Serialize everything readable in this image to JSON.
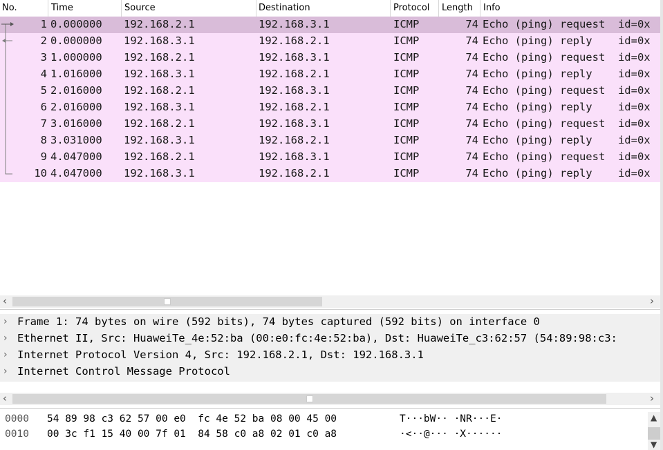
{
  "columns": {
    "no": "No.",
    "time": "Time",
    "source": "Source",
    "destination": "Destination",
    "protocol": "Protocol",
    "length": "Length",
    "info": "Info"
  },
  "packets": [
    {
      "no": "1",
      "time": "0.000000",
      "src": "192.168.2.1",
      "dst": "192.168.3.1",
      "proto": "ICMP",
      "len": "74",
      "info": "Echo (ping) request  id=0x"
    },
    {
      "no": "2",
      "time": "0.000000",
      "src": "192.168.3.1",
      "dst": "192.168.2.1",
      "proto": "ICMP",
      "len": "74",
      "info": "Echo (ping) reply    id=0x"
    },
    {
      "no": "3",
      "time": "1.000000",
      "src": "192.168.2.1",
      "dst": "192.168.3.1",
      "proto": "ICMP",
      "len": "74",
      "info": "Echo (ping) request  id=0x"
    },
    {
      "no": "4",
      "time": "1.016000",
      "src": "192.168.3.1",
      "dst": "192.168.2.1",
      "proto": "ICMP",
      "len": "74",
      "info": "Echo (ping) reply    id=0x"
    },
    {
      "no": "5",
      "time": "2.016000",
      "src": "192.168.2.1",
      "dst": "192.168.3.1",
      "proto": "ICMP",
      "len": "74",
      "info": "Echo (ping) request  id=0x"
    },
    {
      "no": "6",
      "time": "2.016000",
      "src": "192.168.3.1",
      "dst": "192.168.2.1",
      "proto": "ICMP",
      "len": "74",
      "info": "Echo (ping) reply    id=0x"
    },
    {
      "no": "7",
      "time": "3.016000",
      "src": "192.168.2.1",
      "dst": "192.168.3.1",
      "proto": "ICMP",
      "len": "74",
      "info": "Echo (ping) request  id=0x"
    },
    {
      "no": "8",
      "time": "3.031000",
      "src": "192.168.3.1",
      "dst": "192.168.2.1",
      "proto": "ICMP",
      "len": "74",
      "info": "Echo (ping) reply    id=0x"
    },
    {
      "no": "9",
      "time": "4.047000",
      "src": "192.168.2.1",
      "dst": "192.168.3.1",
      "proto": "ICMP",
      "len": "74",
      "info": "Echo (ping) request  id=0x"
    },
    {
      "no": "10",
      "time": "4.047000",
      "src": "192.168.3.1",
      "dst": "192.168.2.1",
      "proto": "ICMP",
      "len": "74",
      "info": "Echo (ping) reply    id=0x"
    }
  ],
  "details": [
    "Frame 1: 74 bytes on wire (592 bits), 74 bytes captured (592 bits) on interface 0",
    "Ethernet II, Src: HuaweiTe_4e:52:ba (00:e0:fc:4e:52:ba), Dst: HuaweiTe_c3:62:57 (54:89:98:c3:",
    "Internet Protocol Version 4, Src: 192.168.2.1, Dst: 192.168.3.1",
    "Internet Control Message Protocol"
  ],
  "bytes": [
    {
      "offset": "0000",
      "hex": "54 89 98 c3 62 57 00 e0  fc 4e 52 ba 08 00 45 00",
      "ascii": "T···bW·· ·NR···E·"
    },
    {
      "offset": "0010",
      "hex": "00 3c f1 15 40 00 7f 01  84 58 c0 a8 02 01 c0 a8",
      "ascii": "·<··@··· ·X······"
    }
  ],
  "icons": {
    "expand": "chevron-right-icon",
    "scroll_left": "chevron-left-icon",
    "scroll_right": "chevron-right-icon"
  },
  "colors": {
    "icmp_row_bg": "#fae0fa",
    "selected_row_bg": "#d9bcd9"
  }
}
